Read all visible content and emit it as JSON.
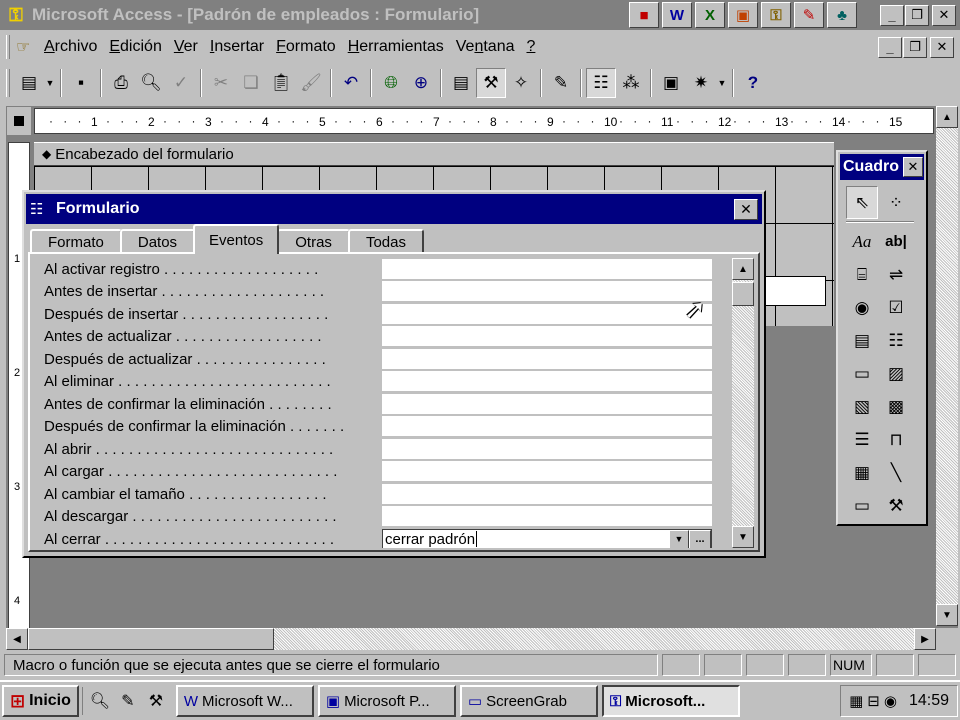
{
  "titlebar": {
    "title": "Microsoft Access - [Padrón de empleados : Formulario]",
    "app_icon": "key-icon",
    "tray_icons": [
      "office-icon",
      "word-icon",
      "excel-icon",
      "powerpoint-icon",
      "access-icon",
      "schedule-icon",
      "binder-icon"
    ]
  },
  "menubar": {
    "items": [
      "Archivo",
      "Edición",
      "Ver",
      "Insertar",
      "Formato",
      "Herramientas",
      "Ventana",
      "?"
    ],
    "underline": [
      "A",
      "E",
      "V",
      "I",
      "F",
      "H",
      "n",
      "?"
    ]
  },
  "ruler": {
    "h_numbers": [
      "1",
      "2",
      "3",
      "4",
      "5",
      "6",
      "7",
      "8",
      "9",
      "10",
      "11",
      "12",
      "13",
      "14",
      "15"
    ],
    "v_numbers": [
      "1",
      "2",
      "3",
      "4"
    ]
  },
  "design": {
    "section_header": "Encabezado del formulario"
  },
  "property_sheet": {
    "title": "Formulario",
    "tabs": [
      "Formato",
      "Datos",
      "Eventos",
      "Otras",
      "Todas"
    ],
    "active_tab": "Eventos",
    "rows": [
      {
        "label": "Al activar registro . . . . . . . . . . . . . . . . . . .",
        "value": ""
      },
      {
        "label": "Antes de insertar . . . . . . . . . . . . . . . . . . . .",
        "value": ""
      },
      {
        "label": "Después de insertar . . . . . . . . . . . . . . . . . .",
        "value": ""
      },
      {
        "label": "Antes de actualizar . . . . . . . . . . . . . . . . . .",
        "value": ""
      },
      {
        "label": "Después de actualizar . . . . . . . . . . . . . . . .",
        "value": ""
      },
      {
        "label": "Al eliminar . . . . . . . . . . . . . . . . . . . . . . . . . .",
        "value": ""
      },
      {
        "label": "Antes de confirmar la eliminación . . . . . . . .",
        "value": ""
      },
      {
        "label": "Después de confirmar la eliminación . . . . . . .",
        "value": ""
      },
      {
        "label": "Al abrir . . . . . . . . . . . . . . . . . . . . . . . . . . . . .",
        "value": ""
      },
      {
        "label": "Al cargar . . . . . . . . . . . . . . . . . . . . . . . . . . . .",
        "value": ""
      },
      {
        "label": "Al cambiar el tamaño . . . . . . . . . . . . . . . . .",
        "value": ""
      },
      {
        "label": "Al descargar . . . . . . . . . . . . . . . . . . . . . . . . .",
        "value": ""
      },
      {
        "label": "Al cerrar . . . . . . . . . . . . . . . . . . . . . . . . . . . .",
        "value": "cerrar padrón"
      }
    ],
    "builder_glyph": "..."
  },
  "toolbox": {
    "title": "Cuadro",
    "tools": [
      {
        "icon": "select-objects-icon",
        "glyph": "⇖"
      },
      {
        "icon": "control-wizards-icon",
        "glyph": "⁘"
      },
      {
        "icon": "label-icon",
        "glyph": "Aa"
      },
      {
        "icon": "text-box-icon",
        "glyph": "ab|"
      },
      {
        "icon": "option-group-icon",
        "glyph": "⌸"
      },
      {
        "icon": "toggle-button-icon",
        "glyph": "⇌"
      },
      {
        "icon": "option-button-icon",
        "glyph": "◉"
      },
      {
        "icon": "check-box-icon",
        "glyph": "☑"
      },
      {
        "icon": "combo-box-icon",
        "glyph": "▤"
      },
      {
        "icon": "list-box-icon",
        "glyph": "☷"
      },
      {
        "icon": "command-button-icon",
        "glyph": "▭"
      },
      {
        "icon": "image-icon",
        "glyph": "▨"
      },
      {
        "icon": "unbound-object-icon",
        "glyph": "▧"
      },
      {
        "icon": "bound-object-icon",
        "glyph": "▩"
      },
      {
        "icon": "page-break-icon",
        "glyph": "☰"
      },
      {
        "icon": "tab-control-icon",
        "glyph": "⊓"
      },
      {
        "icon": "subform-icon",
        "glyph": "▦"
      },
      {
        "icon": "line-icon",
        "glyph": "╲"
      },
      {
        "icon": "rectangle-icon",
        "glyph": "▭"
      },
      {
        "icon": "more-controls-icon",
        "glyph": "⚒"
      }
    ]
  },
  "statusbar": {
    "message": "Macro o función que se ejecuta antes que se cierre el formulario",
    "num": "NUM"
  },
  "taskbar": {
    "start_label": "Inicio",
    "tasks": [
      {
        "label": "Microsoft W...",
        "icon": "word-icon",
        "glyph": "W"
      },
      {
        "label": "Microsoft P...",
        "icon": "powerpoint-icon",
        "glyph": "▣"
      },
      {
        "label": "ScreenGrab",
        "icon": "screengrab-icon",
        "glyph": "▭"
      },
      {
        "label": "Microsoft...",
        "icon": "access-icon",
        "glyph": "⚿"
      }
    ],
    "clock": "14:59"
  }
}
